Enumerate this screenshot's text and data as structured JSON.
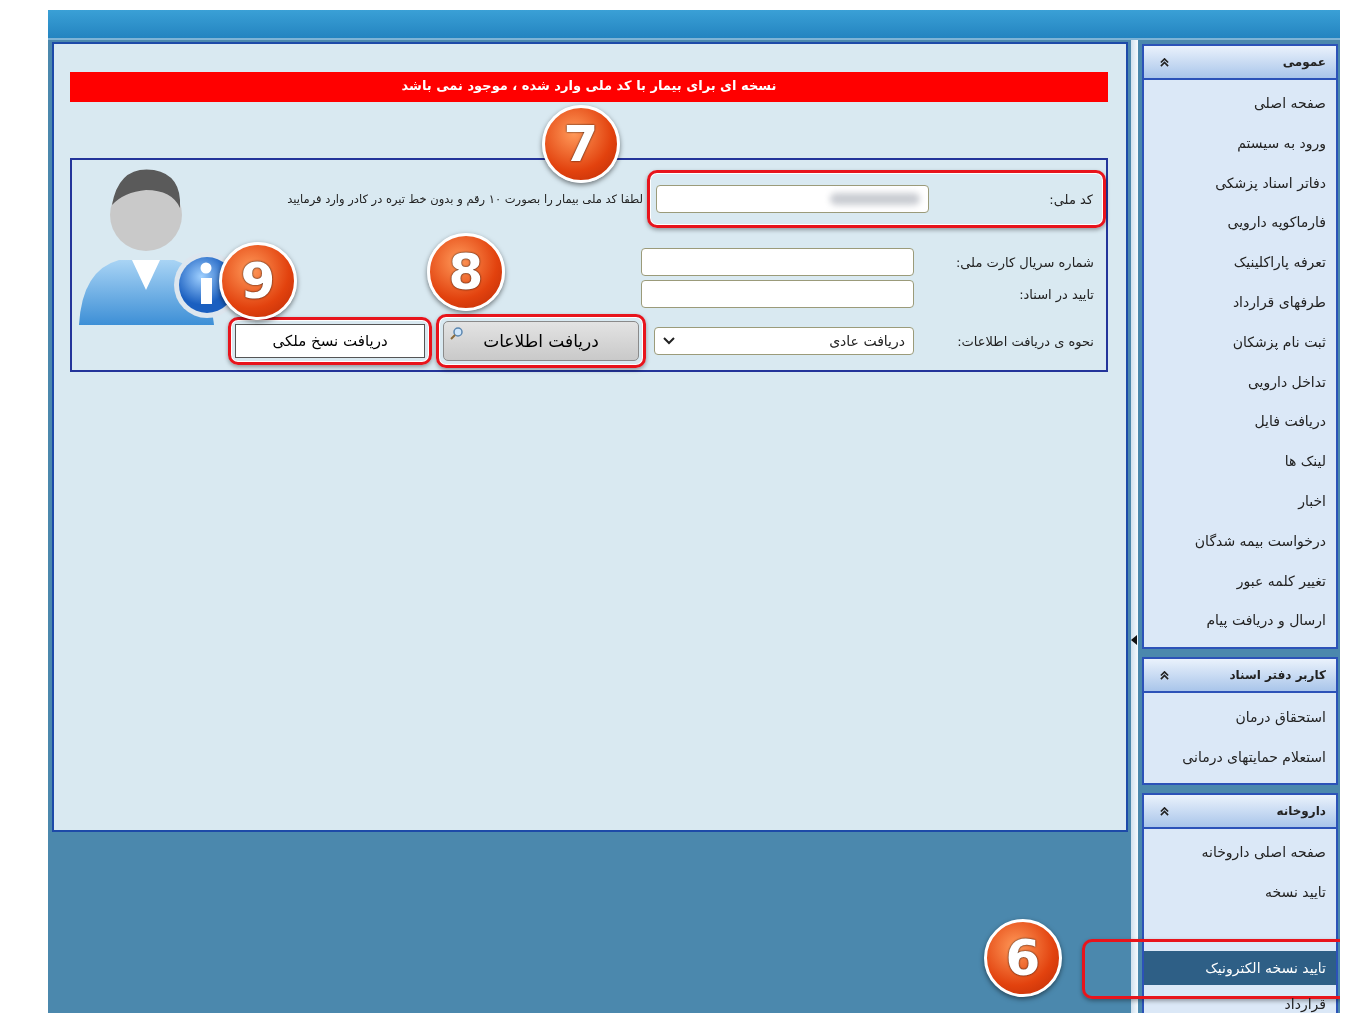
{
  "alert": "نسخه ای برای بیمار با کد ملی وارد شده ، موجود نمی باشد",
  "form": {
    "national_code": {
      "label": "کد ملی:",
      "hint": "لطفا کد ملی بیمار را بصورت ۱۰ رقم و بدون خط تیره در کادر وارد فرمایید",
      "marker": "7"
    },
    "fields": [
      {
        "label": "شماره سریال کارت ملی:"
      },
      {
        "label": "تایید در اسناد:"
      }
    ],
    "method": {
      "label": "نحوه ی دریافت اطلاعات:",
      "value": "دریافت عادی"
    },
    "buttons": [
      {
        "label": "دریافت اطلاعات",
        "kind": "primary",
        "marker": "8"
      },
      {
        "label": "دریافت نسخ ملکی",
        "kind": "plain",
        "marker": "9"
      }
    ]
  },
  "sidebar": [
    {
      "title": "عمومی",
      "expanded": true,
      "items": [
        {
          "label": "صفحه اصلی",
          "selected": false
        },
        {
          "label": "ورود به سیستم",
          "selected": false
        },
        {
          "label": "دفاتر اسناد پزشکی",
          "selected": false
        },
        {
          "label": "فارماکوپه دارویی",
          "selected": false
        },
        {
          "label": "تعرفه پاراکلینیک",
          "selected": false
        },
        {
          "label": "طرفهای قرارداد",
          "selected": false
        },
        {
          "label": "ثبت نام پزشکان",
          "selected": false
        },
        {
          "label": "تداخل دارویی",
          "selected": false
        },
        {
          "label": "دریافت فایل",
          "selected": false
        },
        {
          "label": "لینک ها",
          "selected": false
        },
        {
          "label": "اخبار",
          "selected": false
        },
        {
          "label": "درخواست بیمه شدگان",
          "selected": false
        },
        {
          "label": "تغییر کلمه عبور",
          "selected": false
        },
        {
          "label": "ارسال و دریافت پیام",
          "selected": false
        }
      ]
    },
    {
      "title": "کاربر دفتر اسناد",
      "expanded": true,
      "items": [
        {
          "label": "استحقاق درمان",
          "selected": false
        },
        {
          "label": "استعلام حمایتهای درمانی",
          "selected": false
        }
      ]
    },
    {
      "title": "داروخانه",
      "expanded": true,
      "items": [
        {
          "label": "صفحه اصلی داروخانه",
          "selected": false
        },
        {
          "label": "تایید نسخه",
          "selected": false
        },
        {
          "label": "تایید نسخه الکترونیک",
          "selected": true,
          "marker": "6"
        },
        {
          "label": "قرارداد",
          "selected": false
        }
      ]
    }
  ]
}
